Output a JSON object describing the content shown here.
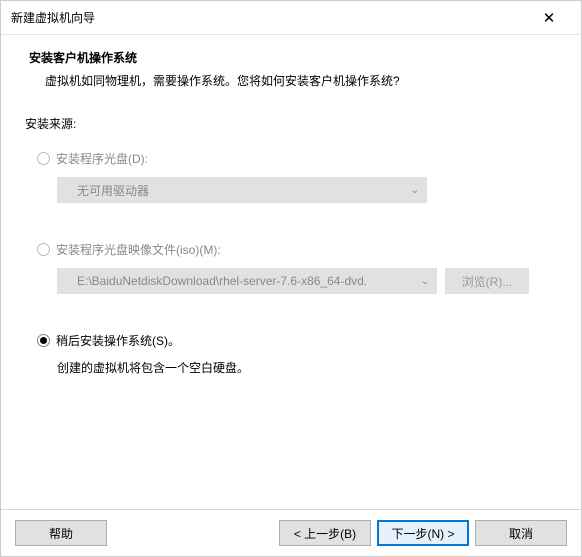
{
  "titlebar": {
    "title": "新建虚拟机向导",
    "close": "✕"
  },
  "header": {
    "title": "安装客户机操作系统",
    "desc": "虚拟机如同物理机，需要操作系统。您将如何安装客户机操作系统?"
  },
  "source": {
    "label": "安装来源:",
    "disc": {
      "label": "安装程序光盘(D):",
      "dropdown": "无可用驱动器"
    },
    "iso": {
      "label": "安装程序光盘映像文件(iso)(M):",
      "path": "E:\\BaiduNetdiskDownload\\rhel-server-7.6-x86_64-dvd.",
      "browse": "浏览(R)..."
    },
    "later": {
      "label": "稍后安装操作系统(S)。",
      "note": "创建的虚拟机将包含一个空白硬盘。"
    }
  },
  "footer": {
    "help": "帮助",
    "back": "< 上一步(B)",
    "next": "下一步(N) >",
    "cancel": "取消"
  }
}
